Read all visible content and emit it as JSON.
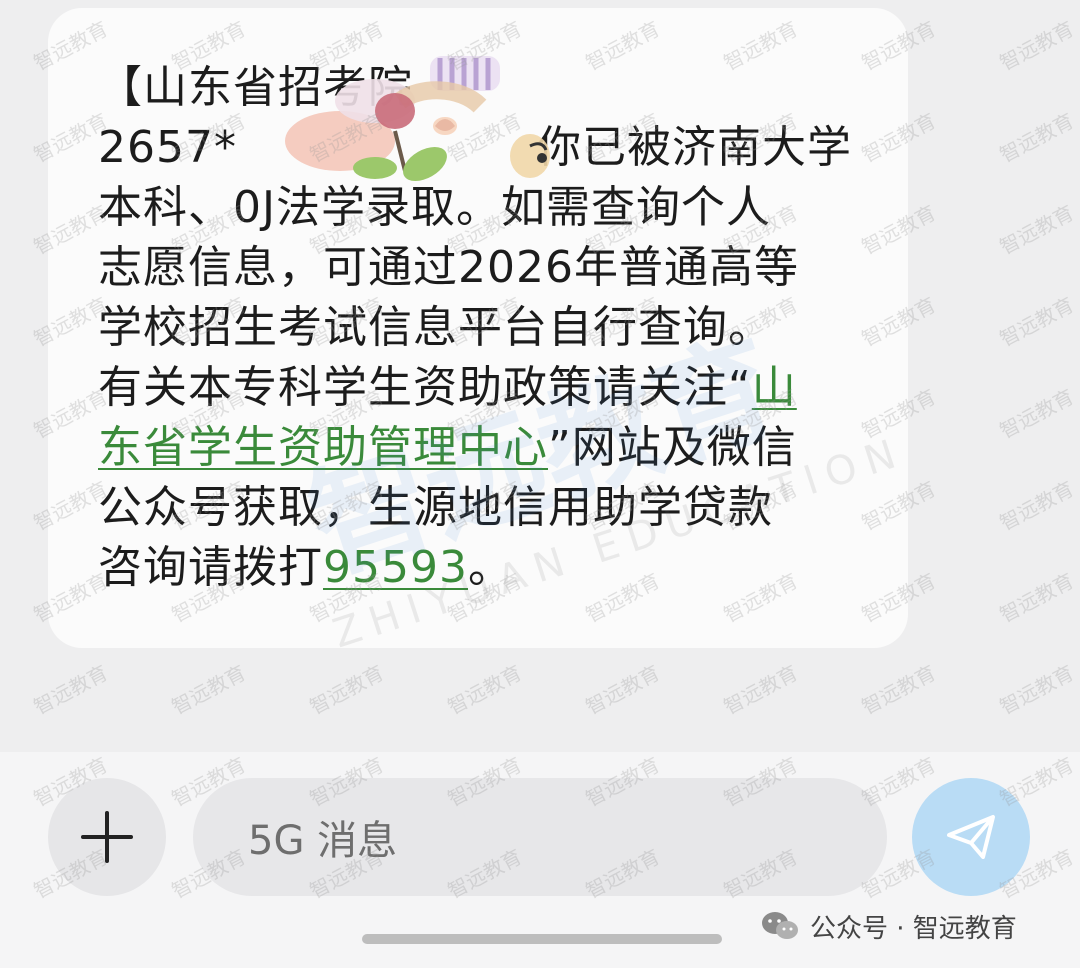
{
  "message": {
    "line1": "【山东省招考院",
    "line2_prefix": "2657*",
    "line2_suffix": "你已被济南大学",
    "line3": "本科、0J法学录取。如需查询个人",
    "line4": "志愿信息，可通过2026年普通高等",
    "line5": "学校招生考试信息平台自行查询。",
    "line6_text": "有关本专科学生资助政策请关注“",
    "line6_link": "山",
    "line7_link": "东省学生资助管理中心",
    "line7_text": "”网站及微信",
    "line8": "公众号获取，生源地信用助学贷款",
    "line9_text": "咨询请拨打",
    "line9_link": "95593",
    "line9_end": "。"
  },
  "input_bar": {
    "placeholder": "5G 消息",
    "plus_icon": "plus-icon",
    "send_icon": "send-icon"
  },
  "attribution": {
    "label": "公众号 · 智远教育",
    "icon": "wechat-icon"
  },
  "watermark": {
    "small": "智远教育",
    "large": "智远教育",
    "large_sub": "ZHIYUAN EDUCATION"
  },
  "colors": {
    "link": "#3a8a3a",
    "send_button": "#b9dcf5",
    "bubble": "#fbfbfb",
    "background": "#eeeeef"
  }
}
